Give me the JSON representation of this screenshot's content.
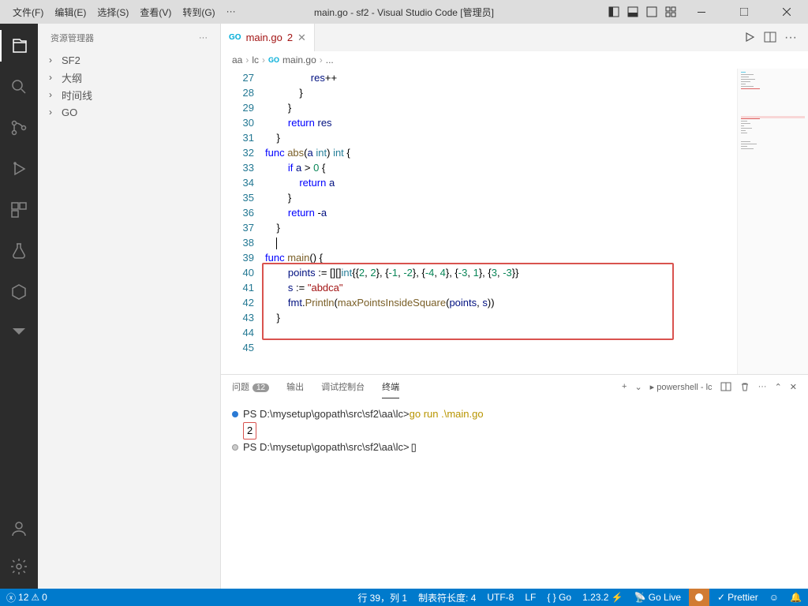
{
  "titlebar": {
    "menu": [
      "文件(F)",
      "编辑(E)",
      "选择(S)",
      "查看(V)",
      "转到(G)",
      "···"
    ],
    "title": "main.go - sf2 - Visual Studio Code [管理员]"
  },
  "sidebar": {
    "header": "资源管理器",
    "items": [
      "SF2",
      "大纲",
      "时间线",
      "GO"
    ]
  },
  "tab": {
    "filename": "main.go",
    "modified": "2"
  },
  "breadcrumb": [
    "aa",
    "lc",
    "main.go",
    "..."
  ],
  "code": {
    "lines": [
      {
        "n": 27,
        "indent": 4,
        "tokens": [
          {
            "t": "id",
            "v": "res"
          },
          {
            "t": "op",
            "v": "++"
          }
        ]
      },
      {
        "n": 28,
        "indent": 3,
        "tokens": [
          {
            "t": "op",
            "v": "}"
          }
        ]
      },
      {
        "n": 29,
        "indent": 2,
        "tokens": [
          {
            "t": "op",
            "v": "}"
          }
        ]
      },
      {
        "n": 30,
        "indent": 2,
        "tokens": [
          {
            "t": "kw",
            "v": "return"
          },
          {
            "t": "op",
            "v": " "
          },
          {
            "t": "id",
            "v": "res"
          }
        ]
      },
      {
        "n": 31,
        "indent": 1,
        "tokens": [
          {
            "t": "op",
            "v": "}"
          }
        ]
      },
      {
        "n": 32,
        "indent": 0,
        "tokens": []
      },
      {
        "n": 33,
        "indent": 0,
        "tokens": [
          {
            "t": "kw",
            "v": "func"
          },
          {
            "t": "op",
            "v": " "
          },
          {
            "t": "fn",
            "v": "abs"
          },
          {
            "t": "op",
            "v": "("
          },
          {
            "t": "id",
            "v": "a"
          },
          {
            "t": "op",
            "v": " "
          },
          {
            "t": "typ",
            "v": "int"
          },
          {
            "t": "op",
            "v": ") "
          },
          {
            "t": "typ",
            "v": "int"
          },
          {
            "t": "op",
            "v": " {"
          }
        ]
      },
      {
        "n": 34,
        "indent": 2,
        "tokens": [
          {
            "t": "kw",
            "v": "if"
          },
          {
            "t": "op",
            "v": " "
          },
          {
            "t": "id",
            "v": "a"
          },
          {
            "t": "op",
            "v": " > "
          },
          {
            "t": "num",
            "v": "0"
          },
          {
            "t": "op",
            "v": " {"
          }
        ]
      },
      {
        "n": 35,
        "indent": 3,
        "tokens": [
          {
            "t": "kw",
            "v": "return"
          },
          {
            "t": "op",
            "v": " "
          },
          {
            "t": "id",
            "v": "a"
          }
        ]
      },
      {
        "n": 36,
        "indent": 2,
        "tokens": [
          {
            "t": "op",
            "v": "}"
          }
        ]
      },
      {
        "n": 37,
        "indent": 2,
        "tokens": [
          {
            "t": "kw",
            "v": "return"
          },
          {
            "t": "op",
            "v": " -"
          },
          {
            "t": "id",
            "v": "a"
          }
        ]
      },
      {
        "n": 38,
        "indent": 1,
        "tokens": [
          {
            "t": "op",
            "v": "}"
          }
        ]
      },
      {
        "n": 39,
        "indent": 1,
        "tokens": [
          {
            "t": "cursor",
            "v": ""
          }
        ]
      },
      {
        "n": 40,
        "indent": 0,
        "tokens": [
          {
            "t": "kw",
            "v": "func"
          },
          {
            "t": "op",
            "v": " "
          },
          {
            "t": "fn",
            "v": "main"
          },
          {
            "t": "op",
            "v": "() {"
          }
        ]
      },
      {
        "n": 41,
        "indent": 2,
        "tokens": [
          {
            "t": "id",
            "v": "points"
          },
          {
            "t": "op",
            "v": " := []"
          },
          {
            "t": "op",
            "v": "[]"
          },
          {
            "t": "typ",
            "v": "int"
          },
          {
            "t": "op",
            "v": "{{"
          },
          {
            "t": "num",
            "v": "2"
          },
          {
            "t": "op",
            "v": ", "
          },
          {
            "t": "num",
            "v": "2"
          },
          {
            "t": "op",
            "v": "}, {"
          },
          {
            "t": "num",
            "v": "-1"
          },
          {
            "t": "op",
            "v": ", "
          },
          {
            "t": "num",
            "v": "-2"
          },
          {
            "t": "op",
            "v": "}, {"
          },
          {
            "t": "num",
            "v": "-4"
          },
          {
            "t": "op",
            "v": ", "
          },
          {
            "t": "num",
            "v": "4"
          },
          {
            "t": "op",
            "v": "}, {"
          },
          {
            "t": "num",
            "v": "-3"
          },
          {
            "t": "op",
            "v": ", "
          },
          {
            "t": "num",
            "v": "1"
          },
          {
            "t": "op",
            "v": "}, {"
          },
          {
            "t": "num",
            "v": "3"
          },
          {
            "t": "op",
            "v": ", "
          },
          {
            "t": "num",
            "v": "-3"
          },
          {
            "t": "op",
            "v": "}}"
          }
        ]
      },
      {
        "n": 42,
        "indent": 2,
        "tokens": [
          {
            "t": "id",
            "v": "s"
          },
          {
            "t": "op",
            "v": " := "
          },
          {
            "t": "str",
            "v": "\"abdca\""
          }
        ]
      },
      {
        "n": 43,
        "indent": 2,
        "tokens": [
          {
            "t": "id",
            "v": "fmt"
          },
          {
            "t": "op",
            "v": "."
          },
          {
            "t": "fn",
            "v": "Println"
          },
          {
            "t": "op",
            "v": "("
          },
          {
            "t": "fn",
            "v": "maxPointsInsideSquare"
          },
          {
            "t": "op",
            "v": "("
          },
          {
            "t": "id",
            "v": "points"
          },
          {
            "t": "op",
            "v": ", "
          },
          {
            "t": "id",
            "v": "s"
          },
          {
            "t": "op",
            "v": "))"
          }
        ]
      },
      {
        "n": 44,
        "indent": 1,
        "tokens": [
          {
            "t": "op",
            "v": "}"
          }
        ]
      },
      {
        "n": 45,
        "indent": 0,
        "tokens": []
      }
    ]
  },
  "terminal": {
    "tabs": [
      {
        "label": "问题",
        "badge": "12"
      },
      {
        "label": "输出"
      },
      {
        "label": "调试控制台"
      },
      {
        "label": "终端",
        "active": true
      }
    ],
    "shell": "powershell - lc",
    "lines": [
      {
        "bullet": "#2a7ad4",
        "prompt": "PS D:\\mysetup\\gopath\\src\\sf2\\aa\\lc>",
        "cmd": "go run .\\main.go"
      },
      {
        "output": "2",
        "boxed": true
      },
      {
        "bullet": "#ccc",
        "prompt": "PS D:\\mysetup\\gopath\\src\\sf2\\aa\\lc>",
        "cursor": true
      }
    ]
  },
  "status": {
    "errors": "12",
    "warnings": "0",
    "right": [
      "行 39，列 1",
      "制表符长度: 4",
      "UTF-8",
      "LF",
      "{ } Go",
      "1.23.2 ⚡",
      "Go Live",
      "Prettier"
    ]
  }
}
